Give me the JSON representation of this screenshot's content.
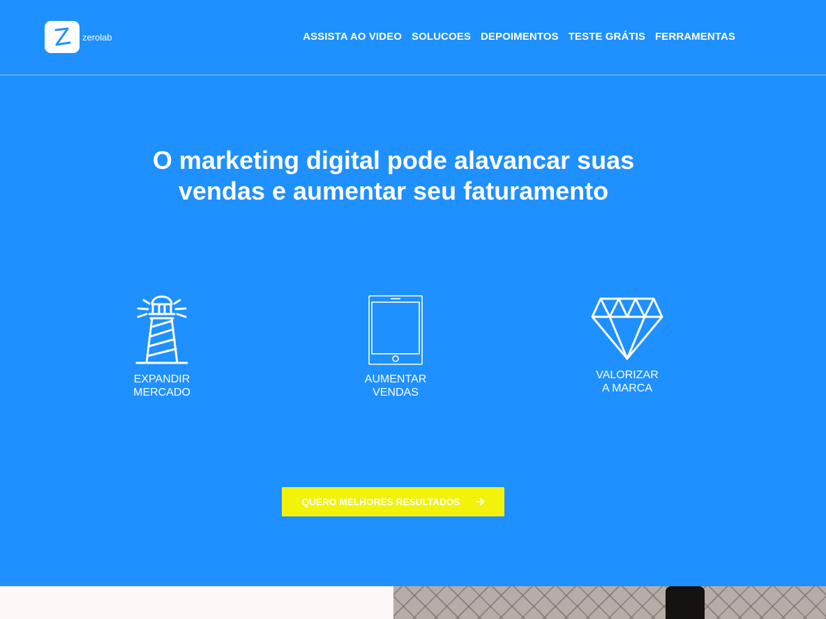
{
  "logo": {
    "text": "zerolab",
    "mark": "Z"
  },
  "nav": {
    "items": [
      {
        "label": "ASSISTA AO VIDEO"
      },
      {
        "label": "SOLUCOES"
      },
      {
        "label": "DEPOIMENTOS"
      },
      {
        "label": "TESTE GRÁTIS"
      },
      {
        "label": "FERRAMENTAS"
      }
    ]
  },
  "hero": {
    "title_line1": "O marketing digital pode alavancar suas",
    "title_line2": "vendas e aumentar seu faturamento"
  },
  "features": [
    {
      "icon": "lighthouse-icon",
      "line1": "EXPANDIR",
      "line2": "MERCADO"
    },
    {
      "icon": "tablet-icon",
      "line1": "AUMENTAR",
      "line2": "VENDAS"
    },
    {
      "icon": "diamond-icon",
      "line1": "VALORIZAR",
      "line2": "A MARCA"
    }
  ],
  "cta": {
    "label": "QUERO MELHORES RESULTADOS",
    "icon": "arrow-right-icon"
  },
  "colors": {
    "background": "#1e90ff",
    "cta": "#f2f20a",
    "text": "#ffffff"
  }
}
